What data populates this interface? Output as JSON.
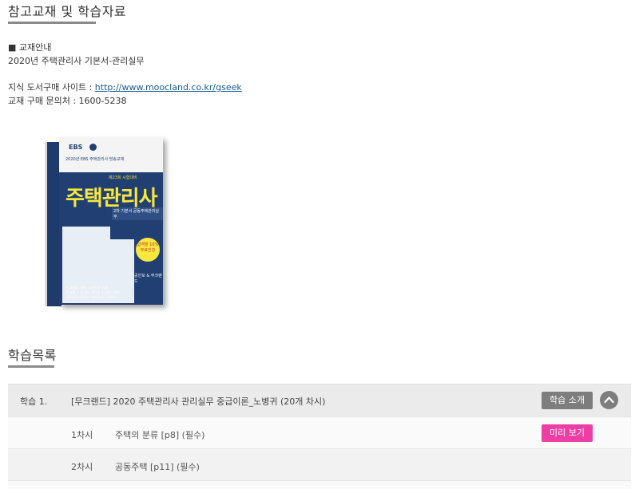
{
  "reference": {
    "title": "참고교재 및 학습자료",
    "guide_label": "■ 교재안내",
    "book_name": "2020년 주택관리사 기본서-관리실무",
    "shop_label": "지식 도서구매 사이트 : ",
    "shop_url": "http://www.moocland.co.kr/gseek",
    "contact": "교재 구매 문의처 : 1600-5238"
  },
  "book_cover": {
    "brand": "EBS",
    "small_subtitle": "2020년 EBS 주택관리사 방송교재",
    "edition": "제23회 시험대비",
    "big_title": "주택관리사",
    "tag": "2차 기본서 공동주택관리실무",
    "badge": "합격할 10% 무료인강",
    "authors": "공인모 & 무크랜드",
    "bullets": "이 교재를 2회독 교수진과 10회\n한 교재 + 한 강의 365일 조건없이 무료\n무료인강 다운로드 공인모 & 무크랜드"
  },
  "study": {
    "title": "학습목록",
    "course": {
      "label": "학습 1.",
      "name": "[무크랜드] 2020 주택관리사 관리실무 중급이론_노병귀 (20개 차시)",
      "intro_button": "학습 소개"
    },
    "lessons": [
      {
        "num": "1차시",
        "title": "주택의 분류 [p8] (필수)",
        "preview_button": "미리 보기"
      },
      {
        "num": "2차시",
        "title": "공동주택 [p11] (필수)"
      }
    ]
  },
  "colors": {
    "accent_pink": "#ee3ea6",
    "button_gray": "#7d7d7d",
    "link_blue": "#1a5a9a"
  }
}
